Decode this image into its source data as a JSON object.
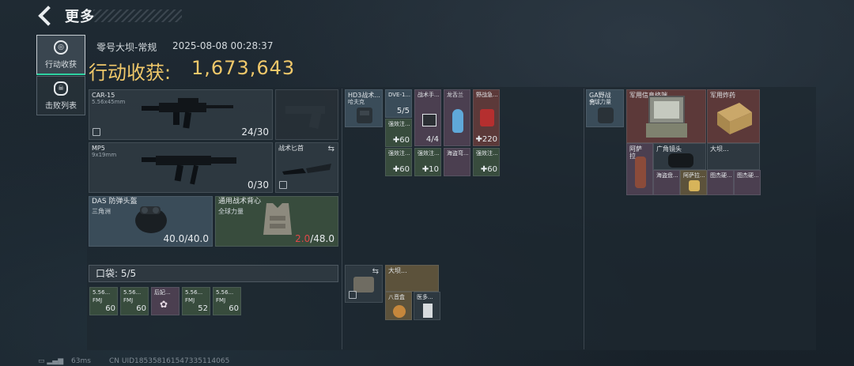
{
  "header": {
    "title": "更多"
  },
  "sidebar": {
    "items": [
      {
        "label": "行动收获",
        "active": true,
        "icon": "target-icon"
      },
      {
        "label": "击败列表",
        "active": false,
        "icon": "skull-icon"
      }
    ]
  },
  "summary": {
    "map": "零号大坝-常规",
    "datetime": "2025-08-08 00:28:37",
    "harvest_label": "行动收获:",
    "harvest_value": "1,673,643"
  },
  "weapons": {
    "primary": {
      "name": "CAR-15",
      "caliber": "5.56x45mm",
      "ammo": "24/30"
    },
    "secondary": {
      "name": "MP5",
      "caliber": "9x19mm",
      "ammo": "0/30"
    },
    "melee": {
      "name": "战术匕首"
    }
  },
  "armor": {
    "helmet": {
      "name": "DAS 防弹头盔",
      "sub": "三角洲",
      "durability": "40.0/40.0"
    },
    "vest": {
      "name": "通用战术背心",
      "sub": "全球力量",
      "durability_current": "2.0",
      "durability_max": "/48.0"
    }
  },
  "pocket": {
    "label": "口袋: 5/5",
    "items": [
      {
        "name": "5.56...",
        "tag": "FMJ",
        "qty": "60"
      },
      {
        "name": "5.56...",
        "tag": "FMJ",
        "qty": "60"
      },
      {
        "name": "后妃...",
        "tag": "",
        "qty": ""
      },
      {
        "name": "5.56...",
        "tag": "FMJ",
        "qty": "52"
      },
      {
        "name": "5.56...",
        "tag": "FMJ",
        "qty": "60"
      }
    ]
  },
  "rig": {
    "items": [
      {
        "name": "HD3战术...",
        "sub": "哈夫克"
      },
      {
        "name": "DVE-1...",
        "qty": "5/5"
      },
      {
        "name": "战术手...",
        "qty": "4/4"
      },
      {
        "name": "龙舌兰",
        "qty": ""
      },
      {
        "name": "野战急...",
        "qty": "220"
      },
      {
        "name": "强效注...",
        "qty": "60"
      },
      {
        "name": "强效注...",
        "qty": "60"
      },
      {
        "name": "强效注...",
        "qty": "10"
      },
      {
        "name": "海盗弯...",
        "qty": ""
      },
      {
        "name": "强效注...",
        "qty": "60"
      }
    ]
  },
  "backpack_small": {
    "items": [
      {
        "name": "大坝...",
        "qty": ""
      },
      {
        "name": "八音盒",
        "qty": ""
      },
      {
        "name": "医多...",
        "qty": ""
      }
    ]
  },
  "backpack": {
    "container": {
      "name": "GA野战背...",
      "sub": "全球力量"
    },
    "items": [
      {
        "name": "军用信息终端"
      },
      {
        "name": "军用炸药"
      },
      {
        "name": "阿萨拉..."
      },
      {
        "name": "广角镜头"
      },
      {
        "name": "大坝..."
      },
      {
        "name": "海盗盘..."
      },
      {
        "name": "阿萨拉..."
      },
      {
        "name": "图杰硬..."
      },
      {
        "name": "图杰硬..."
      }
    ]
  },
  "footer": {
    "ping": "63ms",
    "uid": "CN UID185358161547335114065"
  },
  "colors": {
    "accent": "#f0c86a",
    "active_tab": "#2fd3a3",
    "vest_damage": "#e04848"
  }
}
